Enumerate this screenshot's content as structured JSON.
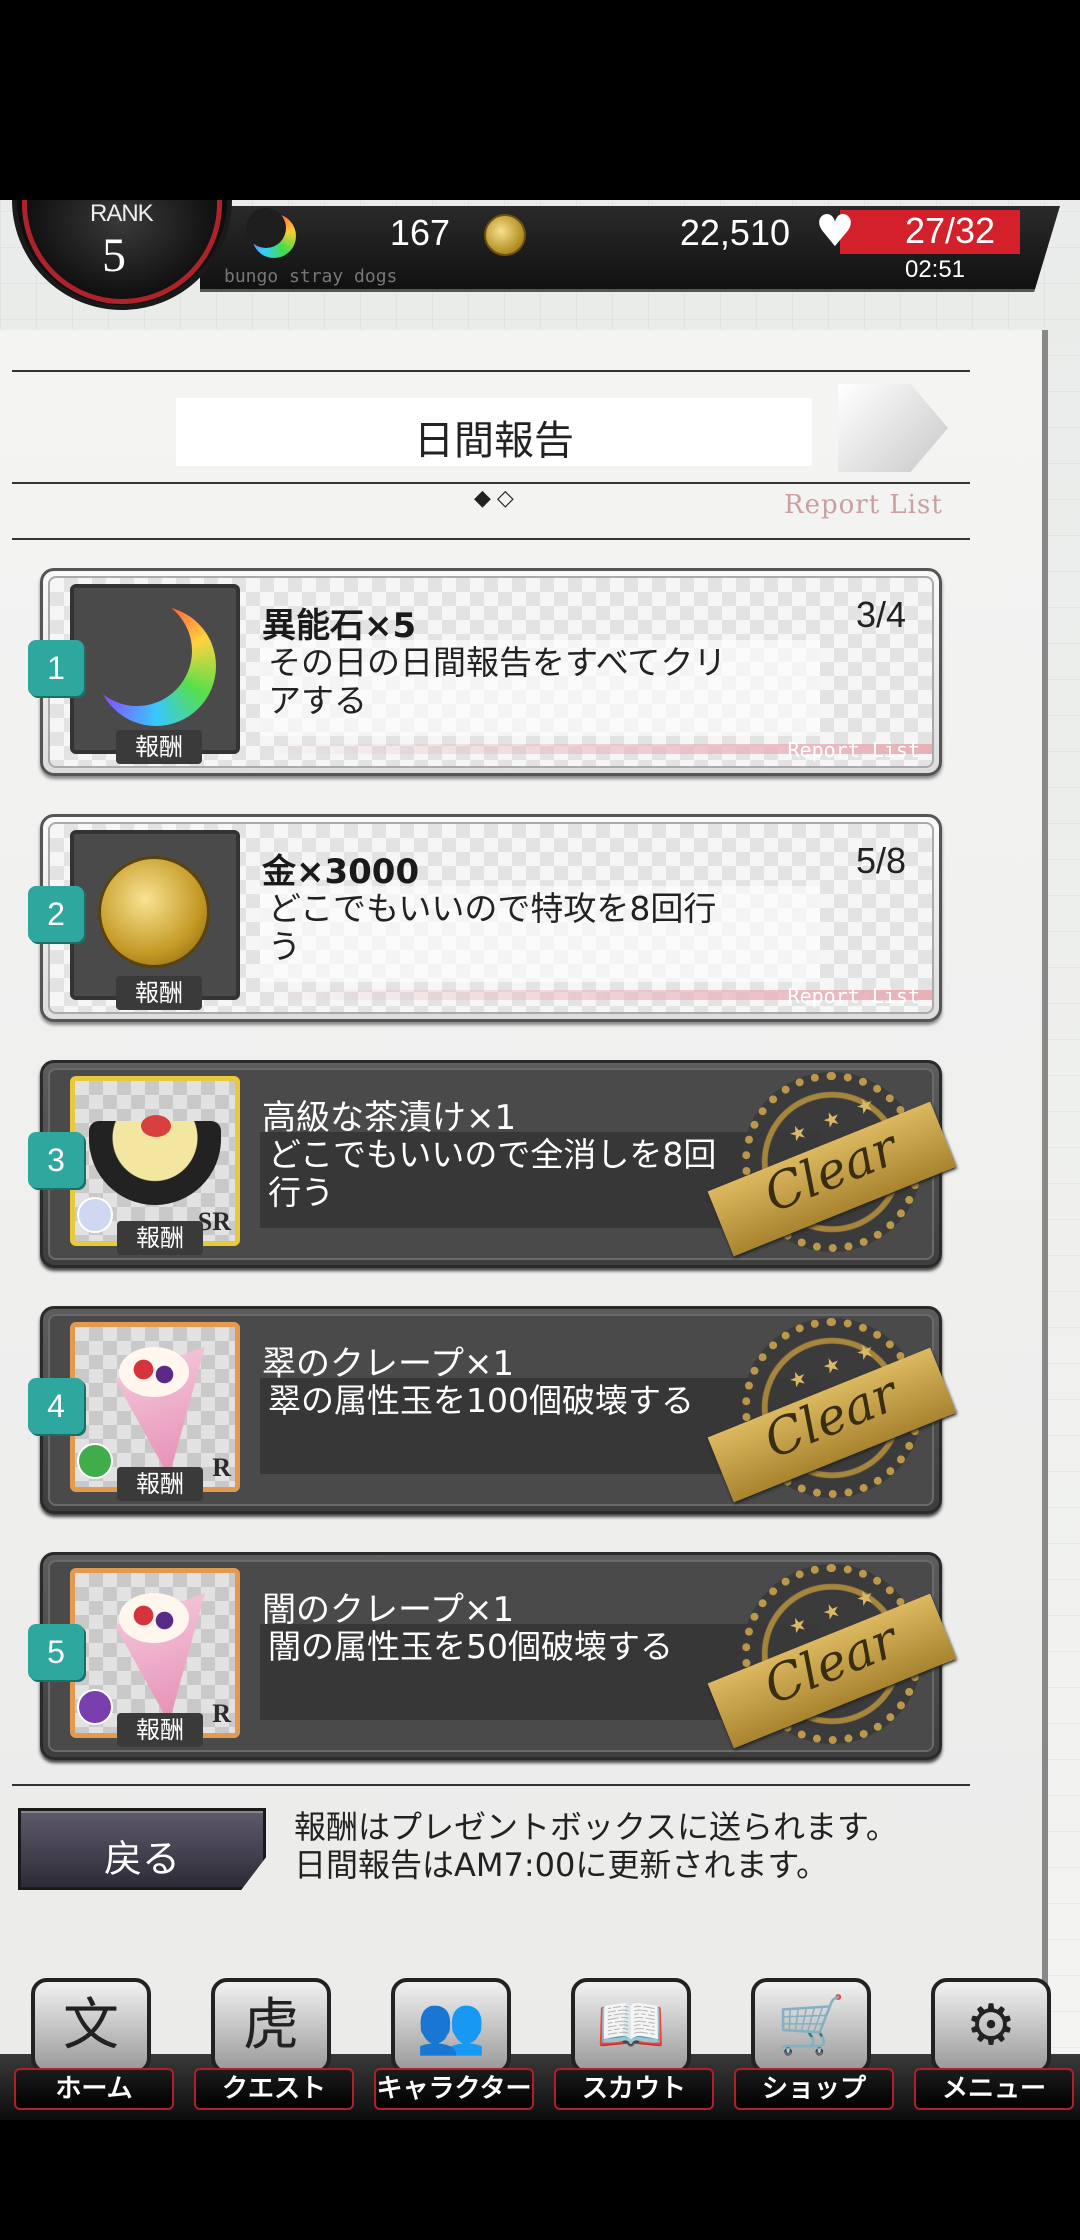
{
  "status": {
    "rank_label": "RANK",
    "rank_value": "5",
    "stones": "167",
    "money": "22,510",
    "ap": "27/32",
    "ap_timer": "02:51",
    "tagline": "bungo stray dogs"
  },
  "header": {
    "title": "日間報告",
    "pager": "◆◇",
    "report_link": "Report List"
  },
  "missions": [
    {
      "number": "1",
      "reward_name": "異能石×5",
      "progress": "3/4",
      "description": "その日の日間報告をすべてクリアする",
      "reward_tag": "報酬",
      "link": "Report List",
      "state": "open",
      "icon": "moon-stone-icon"
    },
    {
      "number": "2",
      "reward_name": "金×3000",
      "progress": "5/8",
      "description": "どこでもいいので特攻を8回行う",
      "reward_tag": "報酬",
      "link": "Report List",
      "state": "open",
      "icon": "gold-coin-icon"
    },
    {
      "number": "3",
      "reward_name": "高級な茶漬け×1",
      "description": "どこでもいいので全消しを8回行う",
      "reward_tag": "報酬",
      "rarity": "SR",
      "state": "clear",
      "icon": "chazuke-bowl-icon"
    },
    {
      "number": "4",
      "reward_name": "翠のクレープ×1",
      "description": "翠の属性玉を100個破壊する",
      "reward_tag": "報酬",
      "rarity": "R",
      "state": "clear",
      "icon": "green-crepe-icon"
    },
    {
      "number": "5",
      "reward_name": "闇のクレープ×1",
      "description": "闇の属性玉を50個破壊する",
      "reward_tag": "報酬",
      "rarity": "R",
      "state": "clear",
      "icon": "dark-crepe-icon"
    }
  ],
  "clear_stamp": {
    "text": "Clear",
    "stars": "★ ★ ★"
  },
  "footer": {
    "back_label": "戻る",
    "notice_line1": "報酬はプレゼントボックスに送られます。",
    "notice_line2": "日間報告はAM7:00に更新されます。"
  },
  "nav": [
    {
      "label": "ホーム",
      "glyph": "文"
    },
    {
      "label": "クエスト",
      "glyph": "虎"
    },
    {
      "label": "キャラクター",
      "glyph": "👥"
    },
    {
      "label": "スカウト",
      "glyph": "📖"
    },
    {
      "label": "ショップ",
      "glyph": "🛒"
    },
    {
      "label": "メニュー",
      "glyph": "⚙"
    }
  ],
  "colors": {
    "accent_red": "#d3202b",
    "teal": "#2ea79e",
    "gold": "#c8a24a"
  }
}
